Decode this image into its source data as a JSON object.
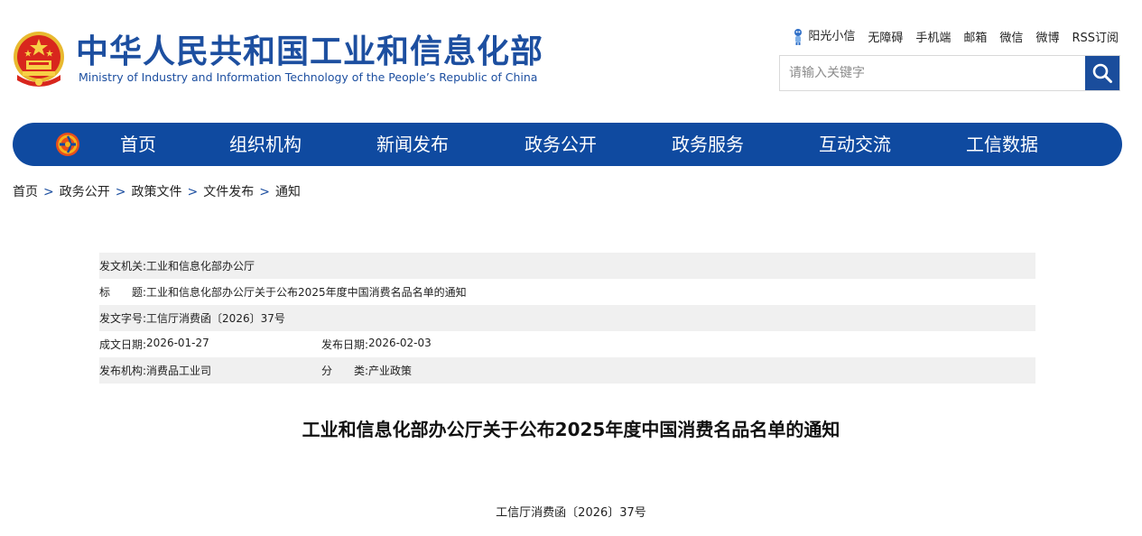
{
  "header": {
    "title_cn": "中华人民共和国工业和信息化部",
    "title_en": "Ministry of Industry and Information Technology of the People’s Republic of China",
    "top_links": [
      "阳光小信",
      "无障碍",
      "手机端",
      "邮箱",
      "微信",
      "微博",
      "RSS订阅"
    ],
    "search": {
      "placeholder": "请输入关键字",
      "value": ""
    }
  },
  "nav": {
    "items": [
      "首页",
      "组织机构",
      "新闻发布",
      "政务公开",
      "政务服务",
      "互动交流",
      "工信数据"
    ]
  },
  "breadcrumb": [
    "首页",
    "政务公开",
    "政策文件",
    "文件发布",
    "通知"
  ],
  "breadcrumb_separator": ">",
  "meta": {
    "issuer_label": "发文机关:",
    "issuer": "工业和信息化部办公厅",
    "title_label": "标　　题:",
    "title": "工业和信息化部办公厅关于公布2025年度中国消费名品名单的通知",
    "doc_no_label": "发文字号:",
    "doc_no": "工信厅消费函〔2026〕37号",
    "created_label": "成文日期:",
    "created": "2026-01-27",
    "published_label": "发布日期:",
    "published": "2026-02-03",
    "org_label": "发布机构:",
    "org": "消费品工业司",
    "category_label": "分　　类:",
    "category": "产业政策"
  },
  "document": {
    "title": "工业和信息化部办公厅关于公布2025年度中国消费名品名单的通知",
    "number": "工信厅消费函〔2026〕37号"
  },
  "colors": {
    "brand_blue": "#0f4aa0",
    "title_blue": "#1d4fa0",
    "row_shade": "#f0f0f0"
  }
}
